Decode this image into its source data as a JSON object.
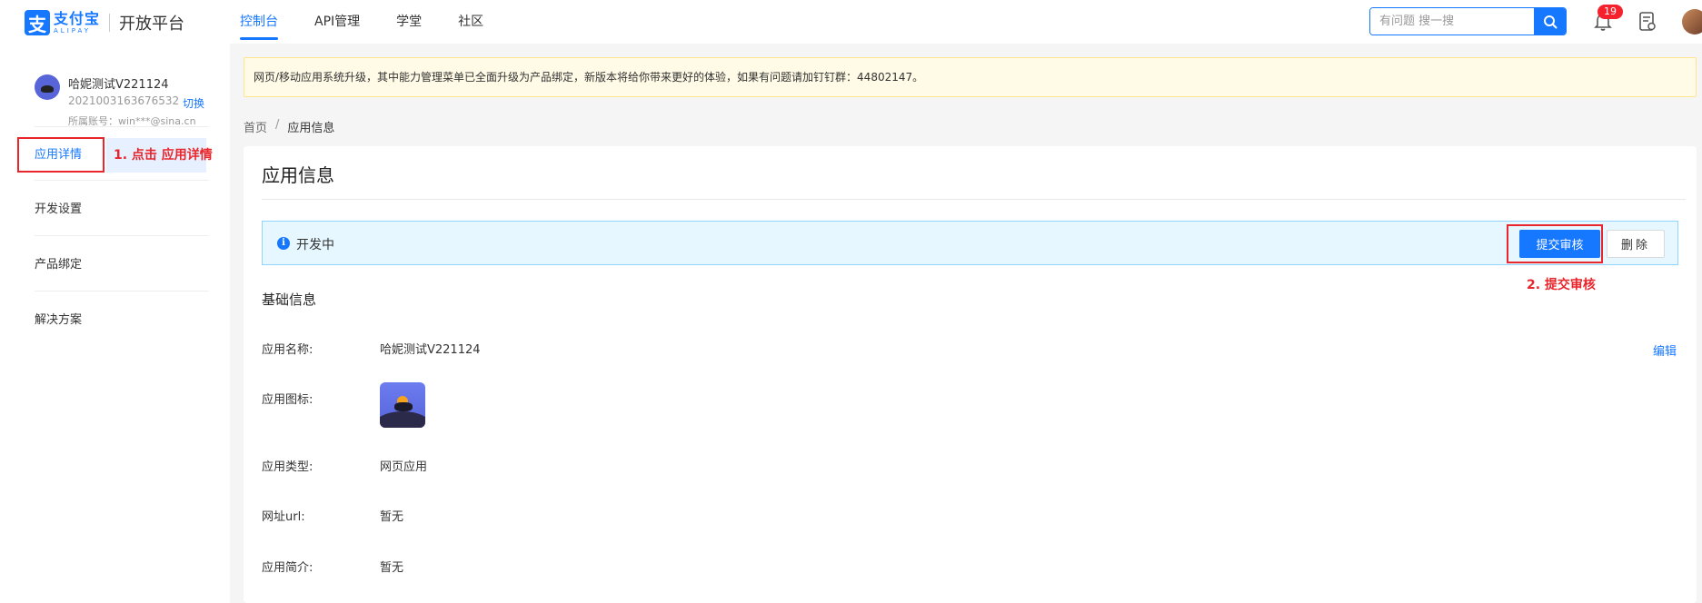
{
  "header": {
    "logo_cn": "支付宝",
    "logo_en": "ALIPAY",
    "platform": "开放平台",
    "nav": [
      {
        "label": "控制台",
        "active": true
      },
      {
        "label": "API管理",
        "active": false
      },
      {
        "label": "学堂",
        "active": false
      },
      {
        "label": "社区",
        "active": false
      }
    ],
    "search_placeholder": "有问题 搜一搜",
    "notification_count": "19"
  },
  "sidebar": {
    "user_name": "哈妮测试V221124",
    "user_id": "2021003163676532",
    "switch_label": "切换",
    "account": "所属账号：win***@sina.cn",
    "menu": [
      {
        "label": "应用详情",
        "active": true
      },
      {
        "label": "开发设置",
        "active": false
      },
      {
        "label": "产品绑定",
        "active": false
      },
      {
        "label": "解决方案",
        "active": false
      }
    ]
  },
  "annotations": {
    "step1": "1. 点击 应用详情",
    "step2": "2. 提交审核"
  },
  "notice": "网页/移动应用系统升级，其中能力管理菜单已全面升级为产品绑定，新版本将给你带来更好的体验，如果有问题请加钉钉群：44802147。",
  "breadcrumb": {
    "home": "首页",
    "separator": "/",
    "current": "应用信息"
  },
  "panel": {
    "title": "应用信息",
    "status": "开发中",
    "submit_label": "提交审核",
    "delete_label": "删除",
    "section_title": "基础信息",
    "edit_label": "编辑",
    "fields": [
      {
        "label": "应用名称:",
        "value": "哈妮测试V221124"
      },
      {
        "label": "应用图标:",
        "value": ""
      },
      {
        "label": "应用类型:",
        "value": "网页应用"
      },
      {
        "label": "网址url:",
        "value": "暂无"
      },
      {
        "label": "应用简介:",
        "value": "暂无"
      }
    ]
  },
  "colors": {
    "primary": "#1677ff",
    "annotation_red": "#e8262b",
    "notice_bg": "#fffbe6",
    "status_bg": "#e6f7ff"
  }
}
